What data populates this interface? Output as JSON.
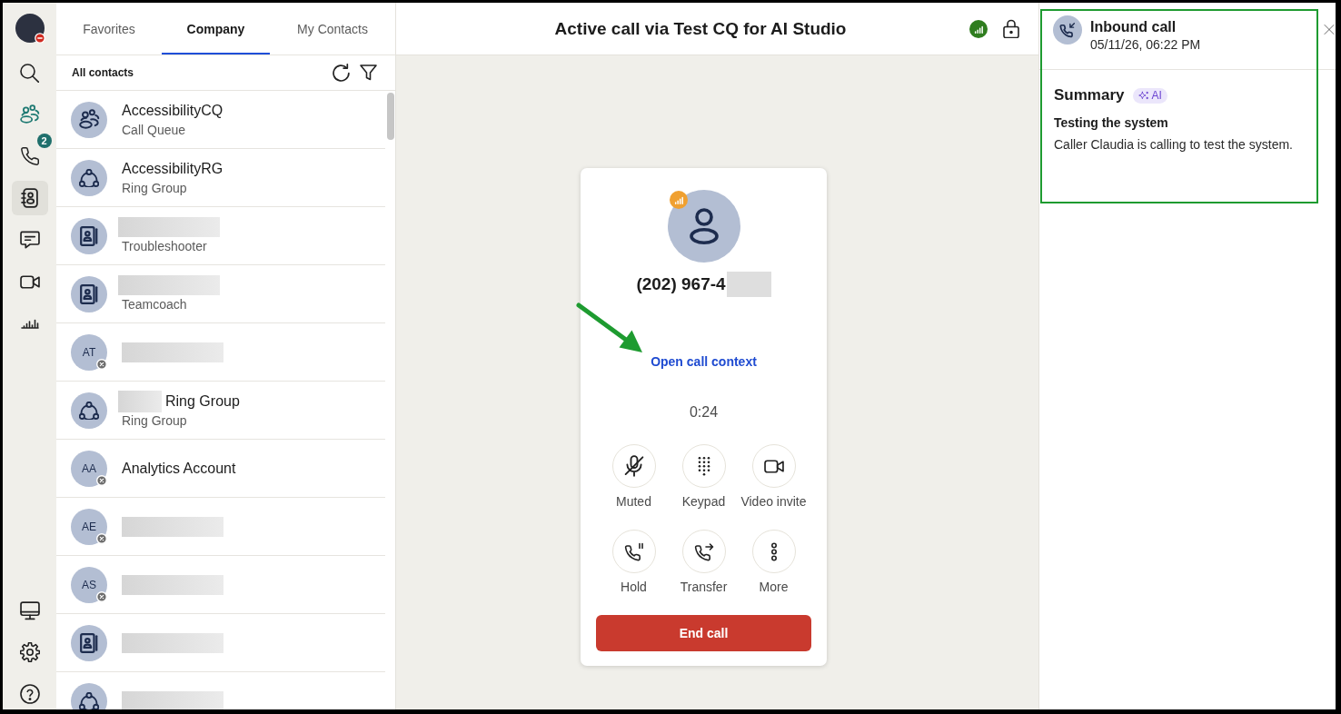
{
  "rail": {
    "profile": {
      "busy": true
    },
    "items": [
      {
        "kind": "search",
        "selected": false
      },
      {
        "kind": "queues",
        "selected": false
      },
      {
        "kind": "calls",
        "selected": false,
        "badge": "2"
      },
      {
        "kind": "contacts",
        "selected": true
      },
      {
        "kind": "messages",
        "selected": false
      },
      {
        "kind": "meetings",
        "selected": false
      },
      {
        "kind": "analytics",
        "selected": false
      }
    ],
    "footer_items": [
      {
        "kind": "device"
      },
      {
        "kind": "settings"
      },
      {
        "kind": "help"
      }
    ]
  },
  "contacts": {
    "tabs": [
      {
        "label": "Favorites",
        "selected": false
      },
      {
        "label": "Company",
        "selected": true
      },
      {
        "label": "My Contacts",
        "selected": false
      }
    ],
    "list_title": "All contacts",
    "items": [
      {
        "kind": "call-queue",
        "name": "AccessibilityCQ",
        "subtitle": "Call Queue",
        "offline": false,
        "redacted": false
      },
      {
        "kind": "ring-group",
        "name": "AccessibilityRG",
        "subtitle": "Ring Group",
        "offline": false,
        "redacted": false
      },
      {
        "kind": "directory",
        "subtitle": "Troubleshooter",
        "offline": false,
        "redacted": true
      },
      {
        "kind": "directory",
        "subtitle": "Teamcoach",
        "offline": false,
        "redacted": true
      },
      {
        "kind": "person",
        "initials": "AT",
        "offline": true,
        "redacted": true
      },
      {
        "kind": "ring-group",
        "name": "Ring Group",
        "subtitle": "Ring Group",
        "offline": false,
        "redacted": true
      },
      {
        "kind": "person",
        "initials": "AA",
        "offline": true,
        "name": "Analytics Account",
        "redacted": false
      },
      {
        "kind": "person",
        "initials": "AE",
        "offline": true,
        "redacted": true
      },
      {
        "kind": "person",
        "initials": "AS",
        "offline": true,
        "redacted": true
      },
      {
        "kind": "directory",
        "offline": false,
        "redacted": true
      },
      {
        "kind": "ring-group",
        "offline": false,
        "redacted": true
      }
    ]
  },
  "call": {
    "title": "Active call via Test CQ for AI Studio",
    "caller": {
      "number": "(202) 967-4",
      "number_redacted": true
    },
    "context_link": {
      "label": "Open call context",
      "annotated": true
    },
    "duration": "0:24",
    "controls": [
      {
        "kind": "mute",
        "label": "Muted"
      },
      {
        "kind": "keypad",
        "label": "Keypad"
      },
      {
        "kind": "video",
        "label": "Video invite"
      },
      {
        "kind": "hold",
        "label": "Hold"
      },
      {
        "kind": "transfer",
        "label": "Transfer"
      },
      {
        "kind": "more",
        "label": "More"
      }
    ],
    "end_button": "End call"
  },
  "context": {
    "highlighted": true,
    "title": "Inbound call",
    "timestamp": "05/11/26, 06:22 PM",
    "summary": {
      "heading": "Summary",
      "badge": "AI",
      "topic": "Testing the system",
      "text": "Caller Claudia is calling to test the system."
    }
  }
}
